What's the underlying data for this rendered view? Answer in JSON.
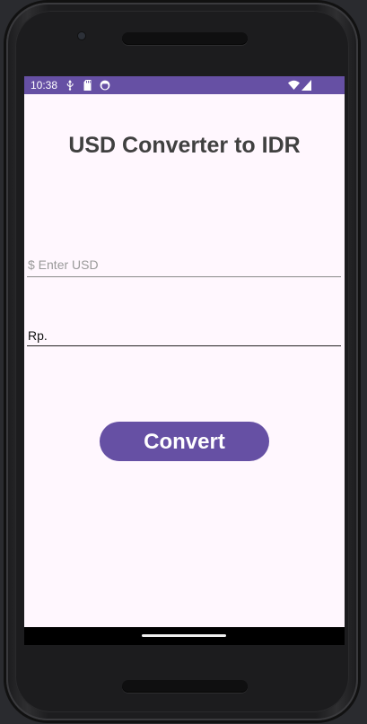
{
  "status_bar": {
    "time": "10:38",
    "icons": [
      "usb-icon",
      "sd-card-icon",
      "face-icon",
      "wifi-icon",
      "signal-icon"
    ],
    "color": "#6650a4"
  },
  "app": {
    "title": "USD Converter to IDR",
    "usd_input": {
      "placeholder": "$ Enter USD",
      "value": ""
    },
    "result_label": "Rp.",
    "convert_label": "Convert",
    "accent_color": "#6650a4",
    "background_color": "#fff7fe"
  }
}
